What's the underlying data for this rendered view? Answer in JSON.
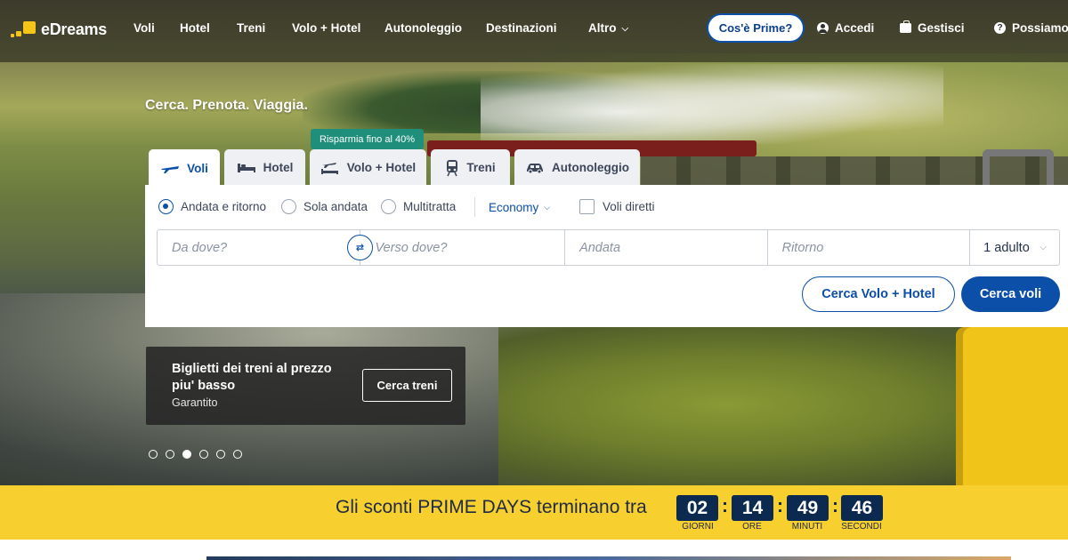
{
  "brand": {
    "name": "eDreams",
    "accent": "#0b4fa8",
    "yellow": "#f7cf2e"
  },
  "nav": {
    "items": [
      "Voli",
      "Hotel",
      "Treni",
      "Volo + Hotel",
      "Autonoleggio",
      "Destinazioni",
      "Altro"
    ],
    "prime_label": "Cos'è Prime?",
    "login_label": "Accedi",
    "manage_label": "Gestisci",
    "help_label": "Possiamo a",
    "help_icon_glyph": "?"
  },
  "hero": {
    "headline": "Cerca. Prenota. Viaggia."
  },
  "tabs": {
    "promo_badge": "Risparmia fino al 40%",
    "items": [
      {
        "label": "Voli",
        "icon": "plane-icon"
      },
      {
        "label": "Hotel",
        "icon": "bed-icon"
      },
      {
        "label": "Volo + Hotel",
        "icon": "plane-bed-icon"
      },
      {
        "label": "Treni",
        "icon": "train-icon"
      },
      {
        "label": "Autonoleggio",
        "icon": "car-icon"
      }
    ],
    "active": "Voli"
  },
  "search": {
    "trip_types": [
      "Andata e ritorno",
      "Sola andata",
      "Multitratta"
    ],
    "selected_trip_type": "Andata e ritorno",
    "cabin_class": "Economy",
    "direct_flights_label": "Voli diretti",
    "direct_flights_checked": false,
    "from_placeholder": "Da dove?",
    "to_placeholder": "Verso dove?",
    "depart_placeholder": "Andata",
    "return_placeholder": "Ritorno",
    "passengers": "1 adulto",
    "swap_glyph": "⇄",
    "btn_flight_hotel": "Cerca Volo + Hotel",
    "btn_flights": "Cerca voli"
  },
  "promo_card": {
    "title": "Biglietti dei treni al prezzo piu' basso",
    "subtitle": "Garantito",
    "button": "Cerca treni"
  },
  "carousel": {
    "count": 6,
    "active_index": 2
  },
  "countdown": {
    "text": "Gli sconti PRIME DAYS terminano tra",
    "units": [
      {
        "value": "02",
        "label": "GIORNI"
      },
      {
        "value": "14",
        "label": "ORE"
      },
      {
        "value": "49",
        "label": "MINUTI"
      },
      {
        "value": "46",
        "label": "SECONDI"
      }
    ]
  }
}
